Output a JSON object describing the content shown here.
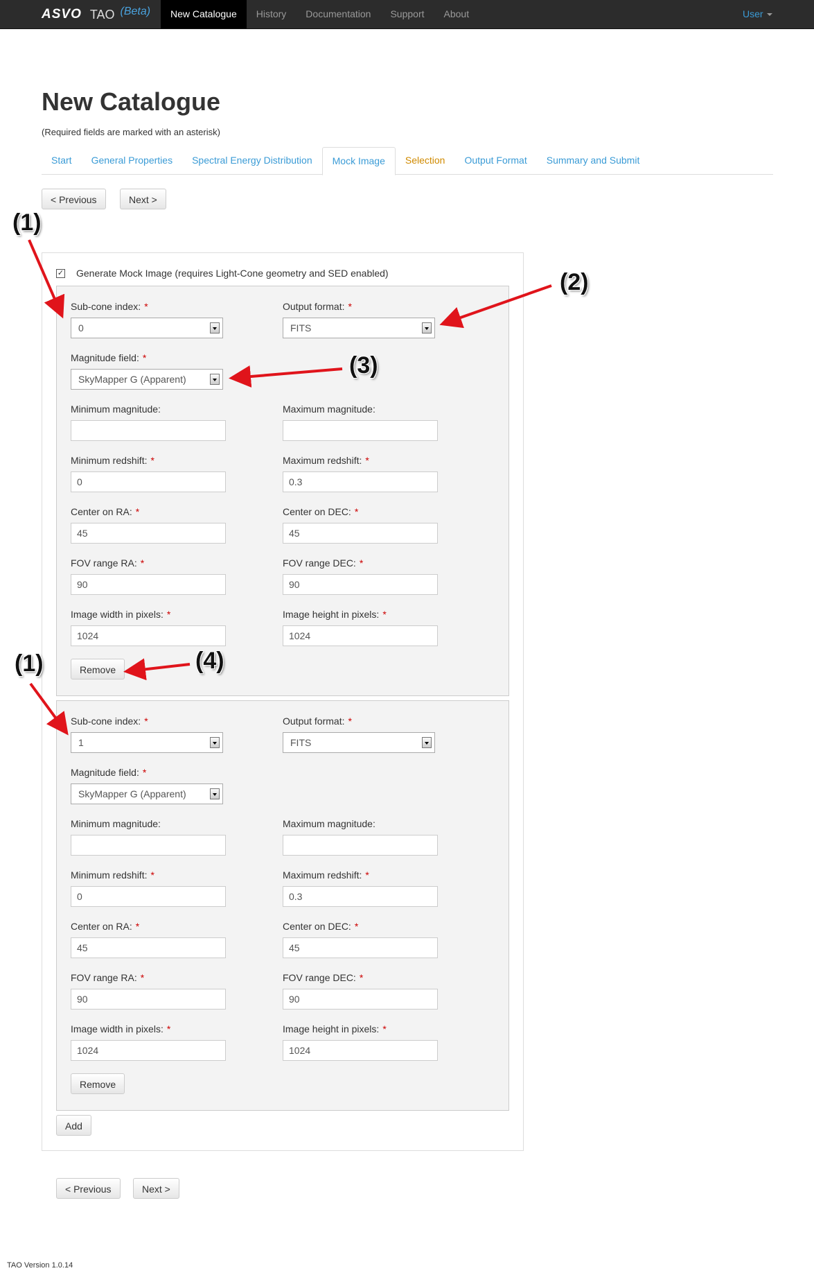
{
  "navbar": {
    "logo_text": "ASVO",
    "product": "TAO",
    "beta": "(Beta)",
    "items": [
      "New Catalogue",
      "History",
      "Documentation",
      "Support",
      "About"
    ],
    "active_index": 0,
    "user": "User"
  },
  "page": {
    "title": "New Catalogue",
    "required_note": "(Required fields are marked with an asterisk)"
  },
  "tabs": {
    "items": [
      "Start",
      "General Properties",
      "Spectral Energy Distribution",
      "Mock Image",
      "Selection",
      "Output Format",
      "Summary and Submit"
    ],
    "active": "Mock Image",
    "warning": "Selection"
  },
  "buttons": {
    "previous": "< Previous",
    "next": "Next >",
    "remove": "Remove",
    "add": "Add"
  },
  "generate": {
    "checked": true,
    "label": "Generate Mock Image (requires Light-Cone geometry and SED enabled)"
  },
  "labels": {
    "subcone": "Sub-cone index:",
    "output_format": "Output format:",
    "magnitude_field": "Magnitude field:",
    "min_mag": "Minimum magnitude:",
    "max_mag": "Maximum magnitude:",
    "min_z": "Minimum redshift:",
    "max_z": "Maximum redshift:",
    "center_ra": "Center on RA:",
    "center_dec": "Center on DEC:",
    "fov_ra": "FOV range RA:",
    "fov_dec": "FOV range DEC:",
    "width_px": "Image width in pixels:",
    "height_px": "Image height in pixels:",
    "required_mark": "*"
  },
  "images": [
    {
      "subcone": "0",
      "output_format": "FITS",
      "magnitude_field": "SkyMapper G (Apparent)",
      "min_mag": "",
      "max_mag": "",
      "min_z": "0",
      "max_z": "0.3",
      "center_ra": "45",
      "center_dec": "45",
      "fov_ra": "90",
      "fov_dec": "90",
      "width_px": "1024",
      "height_px": "1024"
    },
    {
      "subcone": "1",
      "output_format": "FITS",
      "magnitude_field": "SkyMapper G (Apparent)",
      "min_mag": "",
      "max_mag": "",
      "min_z": "0",
      "max_z": "0.3",
      "center_ra": "45",
      "center_dec": "45",
      "fov_ra": "90",
      "fov_dec": "90",
      "width_px": "1024",
      "height_px": "1024"
    }
  ],
  "annotations": [
    "(1)",
    "(2)",
    "(3)",
    "(4)",
    "(1)"
  ],
  "footer": "TAO Version 1.0.14",
  "colors": {
    "link": "#3a9bd6",
    "warning_tab": "#d08a00",
    "required": "#cc0000",
    "arrow": "#e0141b",
    "navbar": "#2c2c2c"
  }
}
